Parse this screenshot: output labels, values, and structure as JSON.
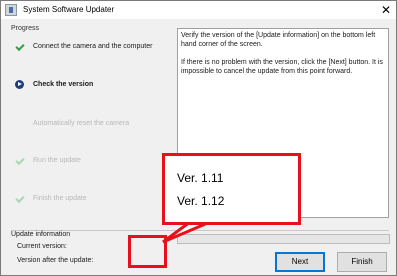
{
  "window": {
    "title": "System Software Updater",
    "close_glyph": "✕"
  },
  "progress": {
    "label": "Progress",
    "steps": [
      {
        "label": "Connect the camera and the computer",
        "state": "done",
        "icon": "check-icon"
      },
      {
        "label": "Check the version",
        "state": "current",
        "icon": "arrow-icon"
      },
      {
        "label": "Automatically reset the camera",
        "state": "pending",
        "icon": "none"
      },
      {
        "label": "Run the update",
        "state": "pending",
        "icon": "check-icon"
      },
      {
        "label": "Finish the update",
        "state": "pending",
        "icon": "check-icon"
      }
    ]
  },
  "info": {
    "paragraph1": "Verify the version of the [Update information] on the bottom left hand corner of the screen.",
    "paragraph2": "If there is no problem with the version, click the [Next] button. It is impossible to cancel the update from this point forward."
  },
  "update_info": {
    "label": "Update information",
    "current_version_label": "Current version:",
    "after_update_label": "Version after the update:"
  },
  "buttons": {
    "next": "Next",
    "finish": "Finish"
  },
  "callout": {
    "current_version": "Ver. 1.11",
    "after_update_version": "Ver. 1.12"
  },
  "colors": {
    "highlight": "#e8101a",
    "done_check": "#2ea043",
    "current_arrow": "#1f3d7a"
  }
}
